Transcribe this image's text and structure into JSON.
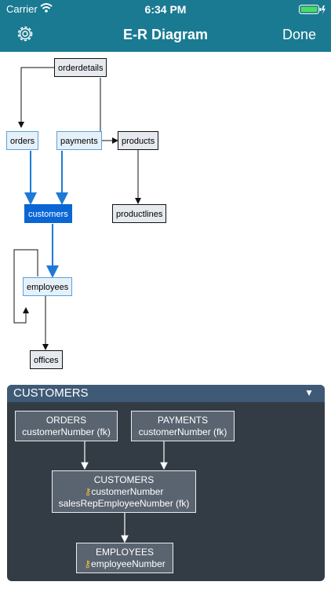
{
  "status_bar": {
    "carrier": "Carrier",
    "time": "6:34 PM"
  },
  "nav": {
    "title": "E-R Diagram",
    "done_label": "Done",
    "settings_icon": "gear-icon"
  },
  "diagram": {
    "nodes": {
      "orderdetails": "orderdetails",
      "orders": "orders",
      "payments": "payments",
      "products": "products",
      "customers": "customers",
      "productlines": "productlines",
      "employees": "employees",
      "offices": "offices"
    },
    "selected": "customers",
    "colors": {
      "selected": "#0a66d6",
      "related": "#5aa2de",
      "other": "#111111"
    }
  },
  "panel": {
    "title": "CUSTOMERS",
    "toggle": "▼",
    "entities": {
      "orders": {
        "name": "ORDERS",
        "fields": [
          "customerNumber (fk)"
        ]
      },
      "payments": {
        "name": "PAYMENTS",
        "fields": [
          "customerNumber (fk)"
        ]
      },
      "customers": {
        "name": "CUSTOMERS",
        "key": "customerNumber",
        "fields": [
          "salesRepEmployeeNumber (fk)"
        ]
      },
      "employees": {
        "name": "EMPLOYEES",
        "key": "employeeNumber"
      }
    },
    "key_icon": "key-icon"
  }
}
